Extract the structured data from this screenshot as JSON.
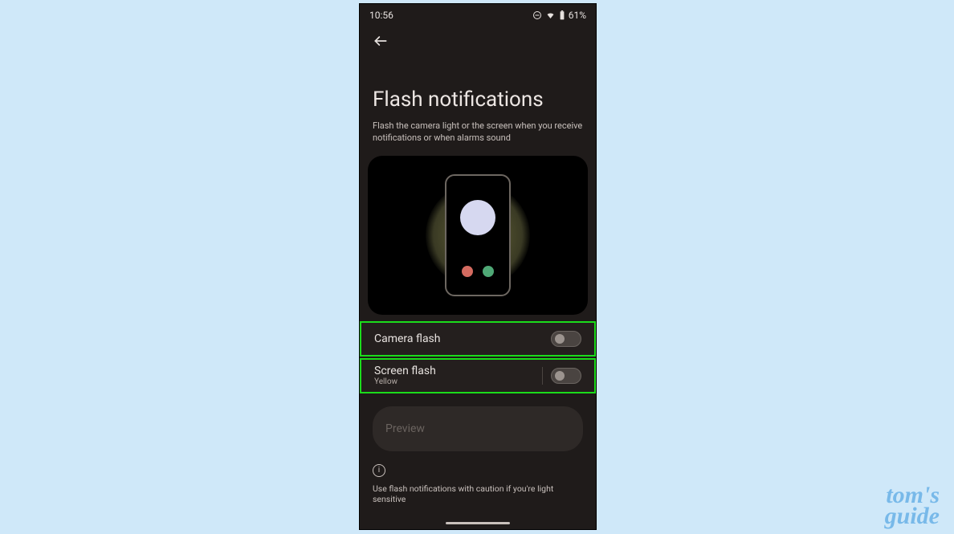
{
  "status": {
    "time": "10:56",
    "battery_pct": "61%"
  },
  "page": {
    "title": "Flash notifications",
    "subtitle": "Flash the camera light or the screen when you receive notifications or when alarms sound"
  },
  "settings": {
    "camera_flash": {
      "label": "Camera flash",
      "enabled": false
    },
    "screen_flash": {
      "label": "Screen flash",
      "color_label": "Yellow",
      "enabled": false
    }
  },
  "preview": {
    "label": "Preview"
  },
  "footer": {
    "info_text": "Use flash notifications with caution if you're light sensitive"
  },
  "watermark": {
    "line1": "tom's",
    "line2": "guide"
  },
  "highlight_color": "#1bdc1b"
}
